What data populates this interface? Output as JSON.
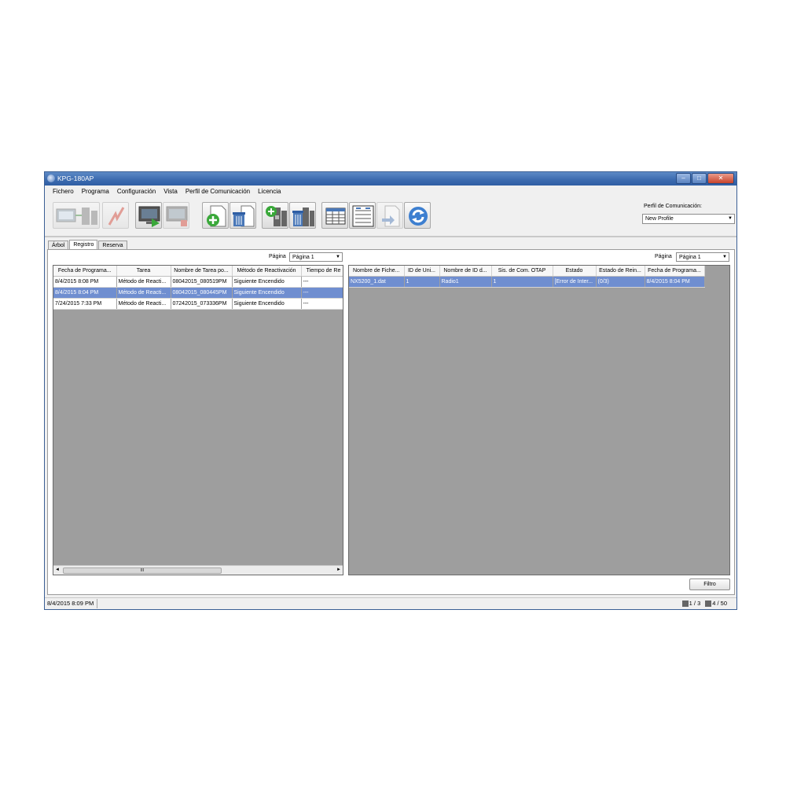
{
  "window": {
    "title": "KPG-180AP",
    "buttons": {
      "minimize": "–",
      "maximize": "□",
      "close": "✕"
    }
  },
  "menu": [
    "Fichero",
    "Programa",
    "Configuración",
    "Vista",
    "Perfil de Comunicación",
    "Licencia"
  ],
  "toolbar": {
    "icons": [
      "radio-program-icon",
      "write-icon",
      "monitor-play-icon",
      "monitor-stop-icon",
      "new-task-icon",
      "delete-task-icon",
      "add-radio-icon",
      "delete-radio-icon",
      "table-view-icon",
      "columns-settings-icon",
      "export-icon",
      "refresh-icon"
    ]
  },
  "profile": {
    "label": "Perfil de Comunicación:",
    "value": "New Profile"
  },
  "tabs": [
    "Árbol",
    "Registro",
    "Reserva"
  ],
  "left_pane": {
    "page_label": "Página",
    "page_value": "Página 1",
    "columns": [
      "Fecha de Programa...",
      "Tarea",
      "Nombre de Tarea po...",
      "Método de Reactivación",
      "Tiempo de Re"
    ],
    "rows": [
      [
        "8/4/2015 8:08 PM",
        "Método de Reacti...",
        "08042015_080519PM",
        "Siguiente Encendido",
        "---"
      ],
      [
        "8/4/2015 8:04 PM",
        "Método de Reacti...",
        "08042015_080445PM",
        "Siguiente Encendido",
        "---"
      ],
      [
        "7/24/2015 7:33 PM",
        "Método de Reacti...",
        "07242015_073336PM",
        "Siguiente Encendido",
        "---"
      ]
    ],
    "selected_row": 1,
    "scroll_grip": "III"
  },
  "right_pane": {
    "page_label": "Página",
    "page_value": "Página 1",
    "columns": [
      "Nombre de Fiche...",
      "ID de Uni...",
      "Nombre de ID d...",
      "Sis. de Com. OTAP",
      "Estado",
      "Estado de Rein...",
      "Fecha de Programa..."
    ],
    "rows": [
      [
        "NX5200_1.dat",
        "1",
        "Radio1",
        "1",
        "[Error de Inter...",
        "(0/3)",
        "8/4/2015 8:04 PM"
      ]
    ],
    "selected_row": 0
  },
  "filter_button": "Filtro",
  "status": {
    "datetime": "8/4/2015 8:09 PM",
    "page_count": "1 / 3",
    "item_count": "4 / 50"
  }
}
